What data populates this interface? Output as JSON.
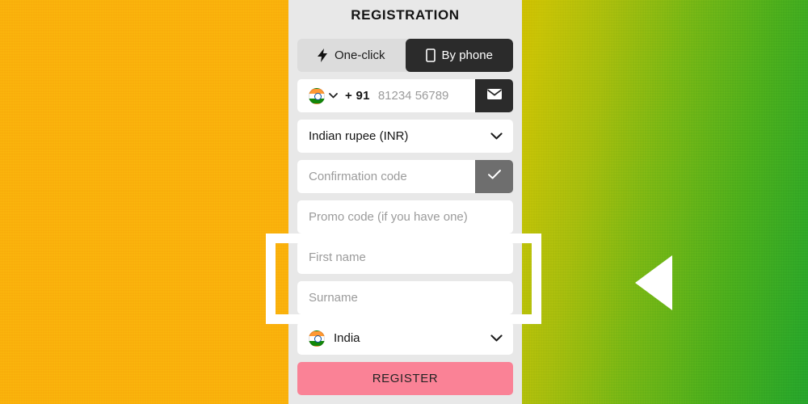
{
  "panel": {
    "title": "REGISTRATION",
    "tabs": [
      {
        "label": "One-click",
        "icon": "lightning-bolt-icon",
        "active": false
      },
      {
        "label": "By phone",
        "icon": "mobile-phone-icon",
        "active": true
      }
    ],
    "phone": {
      "flag_icon": "india-flag-icon",
      "chevron_icon": "chevron-down-icon",
      "dial_code": "+ 91",
      "placeholder": "81234 56789",
      "action_icon": "envelope-icon"
    },
    "currency": {
      "value": "Indian rupee (INR)",
      "chevron_icon": "chevron-down-icon"
    },
    "confirmation": {
      "placeholder": "Confirmation code",
      "action_icon": "check-icon"
    },
    "promo": {
      "placeholder": "Promo code (if you have one)"
    },
    "first_name": {
      "placeholder": "First name"
    },
    "surname": {
      "placeholder": "Surname"
    },
    "country": {
      "flag_icon": "india-flag-icon",
      "value": "India",
      "chevron_icon": "chevron-down-icon"
    },
    "submit": {
      "label": "REGISTER"
    }
  },
  "overlay": {
    "highlight_color": "#FFFFFF",
    "pointer_icon": "left-triangle-pointer",
    "pointer_color": "#FFFFFF"
  },
  "background": {
    "left_color": "#FAB20B",
    "right_gradient_from": "#CFC000",
    "right_gradient_to": "#27A52C",
    "panel_color": "#E8E8E8",
    "accent_dark": "#2B2B2B",
    "accent_gray": "#6E6E6E",
    "accent_pink": "#FA8296"
  }
}
